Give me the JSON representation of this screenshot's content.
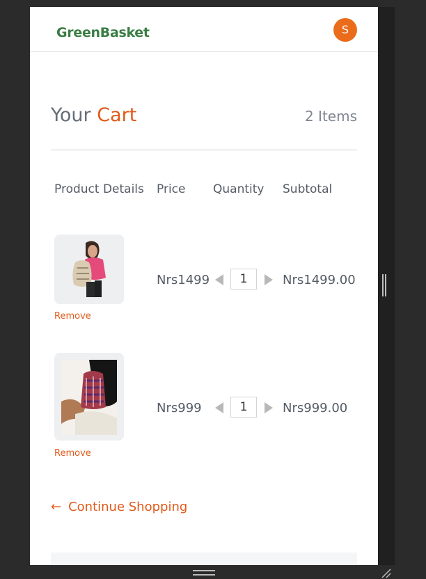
{
  "header": {
    "logo": "GreenBasket",
    "avatar_initial": "S"
  },
  "cart": {
    "title_prefix": "Your",
    "title_accent": "Cart",
    "item_count": "2 Items"
  },
  "columns": [
    "Product Details",
    "Price",
    "Quantity",
    "Subtotal"
  ],
  "items": [
    {
      "image_icon": "backpack-product-image",
      "remove_label": "Remove",
      "price": "Nrs1499",
      "quantity": "1",
      "subtotal": "Nrs1499.00"
    },
    {
      "image_icon": "backpack-product-image",
      "remove_label": "Remove",
      "price": "Nrs999",
      "quantity": "1",
      "subtotal": "Nrs999.00"
    }
  ],
  "continue_shopping": "Continue Shopping",
  "colors": {
    "brand_green": "#3a7d44",
    "accent_orange": "#e05a1a",
    "avatar_orange": "#ea6c1a",
    "text_gray": "#555c66"
  }
}
